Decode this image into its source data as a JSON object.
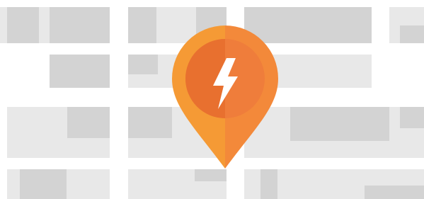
{
  "illustration": {
    "pin_icon": "lightning-bolt-icon",
    "colors": {
      "background": "#ffffff",
      "block_light": "#e8e8e8",
      "block_dark": "#d3d3d3",
      "pin_light": "#f59a35",
      "pin_dark": "#ef7f2d",
      "pin_inner": "#f07a3a",
      "pin_inner_shadow": "#e86f2e",
      "bolt": "#ffffff"
    }
  }
}
